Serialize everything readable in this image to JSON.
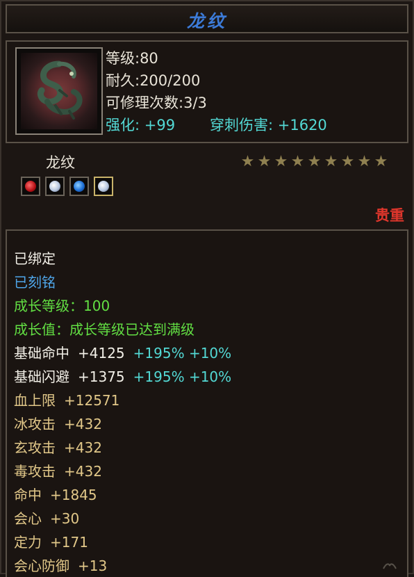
{
  "title": "龙纹",
  "header": {
    "level": "等级:80",
    "durability": "耐久:200/200",
    "repair": "可修理次数:3/3",
    "enhance": "强化: +99",
    "pierce": "穿刺伤害: +1620"
  },
  "item": {
    "name": "龙纹",
    "stars": 9,
    "quality": "贵重",
    "gems": [
      "red-gem-icon",
      "white-gem-icon",
      "blue-gem-icon",
      "white-gem-icon"
    ]
  },
  "status": {
    "bound": "已绑定",
    "engraved": "已刻铭"
  },
  "growth": {
    "level": "成长等级：100",
    "value": "成长值：成长等级已达到满级"
  },
  "attributes": [
    {
      "label": "基础命中",
      "value": "+4125",
      "extra": "+195% +10%"
    },
    {
      "label": "基础闪避",
      "value": "+1375",
      "extra": "+195% +10%"
    },
    {
      "label": "血上限",
      "value": "+12571",
      "extra": ""
    },
    {
      "label": "冰攻击",
      "value": "+432",
      "extra": ""
    },
    {
      "label": "玄攻击",
      "value": "+432",
      "extra": ""
    },
    {
      "label": "毒攻击",
      "value": "+432",
      "extra": ""
    },
    {
      "label": "命中",
      "value": "+1845",
      "extra": ""
    },
    {
      "label": "会心",
      "value": "+30",
      "extra": ""
    },
    {
      "label": "定力",
      "value": "+171",
      "extra": ""
    },
    {
      "label": "会心防御",
      "value": "+13",
      "extra": ""
    }
  ],
  "colors": {
    "title": "#3c7bd8",
    "cyan": "#53d9d5",
    "green": "#62df43",
    "blue": "#4fa6ea",
    "gold": "#e2c889",
    "quality": "#e0362c"
  }
}
